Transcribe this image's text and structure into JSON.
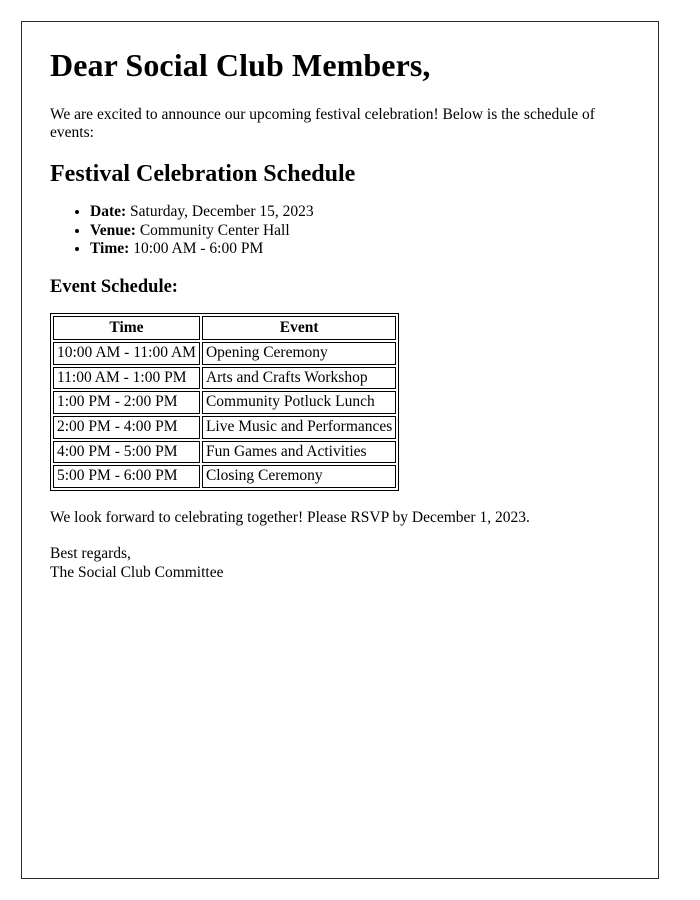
{
  "document": {
    "salutation": "Dear Social Club Members,",
    "intro_paragraph": "We are excited to announce our upcoming festival celebration! Below is the schedule of events:",
    "section_heading": "Festival Celebration Schedule",
    "details": [
      {
        "label": "Date:",
        "value": " Saturday, December 15, 2023"
      },
      {
        "label": "Venue:",
        "value": " Community Center Hall"
      },
      {
        "label": "Time:",
        "value": " 10:00 AM - 6:00 PM"
      }
    ],
    "schedule_heading": "Event Schedule:",
    "table": {
      "columns": [
        "Time",
        "Event"
      ],
      "rows": [
        {
          "time": "10:00 AM - 11:00 AM",
          "event": "Opening Ceremony"
        },
        {
          "time": "11:00 AM - 1:00 PM",
          "event": "Arts and Crafts Workshop"
        },
        {
          "time": "1:00 PM - 2:00 PM",
          "event": "Community Potluck Lunch"
        },
        {
          "time": "2:00 PM - 4:00 PM",
          "event": "Live Music and Performances"
        },
        {
          "time": "4:00 PM - 5:00 PM",
          "event": "Fun Games and Activities"
        },
        {
          "time": "5:00 PM - 6:00 PM",
          "event": "Closing Ceremony"
        }
      ]
    },
    "closing_paragraph": "We look forward to celebrating together! Please RSVP by December 1, 2023.",
    "signoff": "Best regards,",
    "signature": "The Social Club Committee"
  },
  "theme": {
    "page_border_color": "#2b2b2b",
    "text_color": "#000000",
    "background_color": "#ffffff",
    "table_border_color": "#000000"
  }
}
